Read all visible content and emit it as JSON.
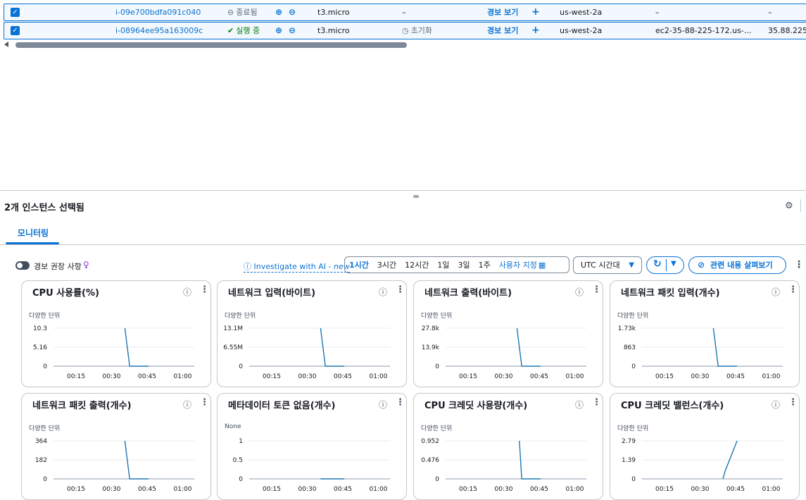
{
  "rows": [
    {
      "id": "i-09e700bdfa091c040",
      "status": "종료됨",
      "type": "t3.micro",
      "check": "–",
      "alarm": "경보 보기",
      "plus": "+",
      "az": "us-west-2a",
      "dns": "–",
      "ip": "–"
    },
    {
      "id": "i-08964ee95a163009c",
      "status": "실행 중",
      "type": "t3.micro",
      "check": "초기화",
      "alarm": "경보 보기",
      "plus": "+",
      "az": "us-west-2a",
      "dns": "ec2-35-88-225-172.us-...",
      "ip": "35.88.225."
    }
  ],
  "panel": {
    "title": "2개 인스턴스 선택됨",
    "tab": "모니터링"
  },
  "toolbar": {
    "alarm_reco": "경보 권장 사항",
    "investigate": "Investigate with AI",
    "investigate_new": "new",
    "ranges": [
      "1시간",
      "3시간",
      "12시간",
      "1일",
      "3일",
      "1주"
    ],
    "custom": "사용자 지정",
    "tz": "UTC 시간대",
    "explore": "관련 내용 살펴보기"
  },
  "chart_data": [
    {
      "type": "line",
      "title": "CPU 사용률(%)",
      "unit_label": "다양한 단위",
      "yticks": [
        "10.3",
        "5.16",
        "0"
      ],
      "ylim": [
        0,
        10.3
      ],
      "xticks": [
        "00:15",
        "00:30",
        "00:45",
        "01:00"
      ],
      "x": [
        0.3833,
        0.4167,
        0.55
      ],
      "y": [
        10.3,
        0,
        0
      ]
    },
    {
      "type": "line",
      "title": "네트워크 입력(바이트)",
      "unit_label": "다양한 단위",
      "yticks": [
        "13.1M",
        "6.55M",
        "0"
      ],
      "ylim": [
        0,
        13.1
      ],
      "xticks": [
        "00:15",
        "00:30",
        "00:45",
        "01:00"
      ],
      "x": [
        0.3833,
        0.4167,
        0.55
      ],
      "y": [
        13.1,
        0,
        0
      ]
    },
    {
      "type": "line",
      "title": "네트워크 출력(바이트)",
      "unit_label": "다양한 단위",
      "yticks": [
        "27.8k",
        "13.9k",
        "0"
      ],
      "ylim": [
        0,
        27.8
      ],
      "xticks": [
        "00:15",
        "00:30",
        "00:45",
        "01:00"
      ],
      "x": [
        0.3833,
        0.4167,
        0.55
      ],
      "y": [
        27.8,
        0,
        0
      ]
    },
    {
      "type": "line",
      "title": "네트워크 패킷 입력(개수)",
      "unit_label": "다양한 단위",
      "yticks": [
        "1.73k",
        "863",
        "0"
      ],
      "ylim": [
        0,
        1.73
      ],
      "xticks": [
        "00:15",
        "00:30",
        "00:45",
        "01:00"
      ],
      "x": [
        0.3833,
        0.4167,
        0.55
      ],
      "y": [
        1.73,
        0,
        0
      ]
    },
    {
      "type": "line",
      "title": "네트워크 패킷 출력(개수)",
      "unit_label": "다양한 단위",
      "yticks": [
        "364",
        "182",
        "0"
      ],
      "ylim": [
        0,
        364
      ],
      "xticks": [
        "00:15",
        "00:30",
        "00:45",
        "01:00"
      ],
      "x": [
        0.3833,
        0.4167,
        0.55
      ],
      "y": [
        364,
        0,
        0
      ]
    },
    {
      "type": "line",
      "title": "메타데이터 토큰 없음(개수)",
      "unit_label": "None",
      "yticks": [
        "1",
        "0.5",
        "0"
      ],
      "ylim": [
        0,
        1
      ],
      "xticks": [
        "00:15",
        "00:30",
        "00:45",
        "01:00"
      ],
      "x": [
        0.3833,
        0.55
      ],
      "y": [
        0,
        0
      ]
    },
    {
      "type": "line",
      "title": "CPU 크레딧 사용량(개수)",
      "unit_label": "다양한 단위",
      "yticks": [
        "0.952",
        "0.476",
        "0"
      ],
      "ylim": [
        0,
        0.952
      ],
      "xticks": [
        "00:15",
        "00:30",
        "00:45",
        "01:00"
      ],
      "x": [
        0.4,
        0.4167,
        0.55
      ],
      "y": [
        0.952,
        0,
        0
      ]
    },
    {
      "type": "line",
      "title": "CPU 크레딧 밸런스(개수)",
      "unit_label": "다양한 단위",
      "yticks": [
        "2.79",
        "1.39",
        "0"
      ],
      "ylim": [
        0,
        2.79
      ],
      "xticks": [
        "00:15",
        "00:30",
        "00:45",
        "01:00"
      ],
      "x": [
        0.45,
        0.4667,
        0.55
      ],
      "y": [
        0,
        0.6,
        2.79
      ]
    }
  ]
}
